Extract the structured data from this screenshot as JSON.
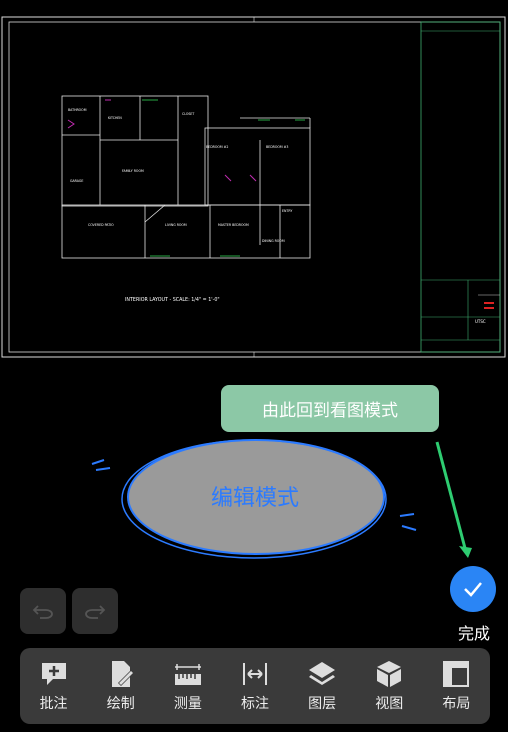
{
  "drawing": {
    "caption": "INTERIOR LAYOUT - SCALE: 1/4\" = 1'-0\"",
    "rooms": [
      "BATHROOM",
      "GARAGE",
      "FAMILY ROOM",
      "KITCHEN",
      "BEDROOM #2",
      "BEDROOM #3",
      "LIVING ROOM",
      "MASTER BEDROOM",
      "COVERED PATIO",
      "DINING ROOM",
      "CLOSET",
      "ENTRY"
    ],
    "title_block": [
      "UTSC"
    ]
  },
  "hint": {
    "text": "由此回到看图模式"
  },
  "edit_mode": {
    "label": "编辑模式"
  },
  "done": {
    "label": "完成"
  },
  "toolbar": {
    "items": [
      {
        "label": "批注",
        "icon": "annotate-icon"
      },
      {
        "label": "绘制",
        "icon": "draw-icon"
      },
      {
        "label": "测量",
        "icon": "measure-icon"
      },
      {
        "label": "标注",
        "icon": "dimension-icon"
      },
      {
        "label": "图层",
        "icon": "layers-icon"
      },
      {
        "label": "视图",
        "icon": "view-cube-icon"
      },
      {
        "label": "布局",
        "icon": "layout-icon"
      }
    ]
  },
  "colors": {
    "accent": "#2a85f5",
    "hint_bg": "#8cc8a6",
    "arrow": "#2ecc71",
    "toolbar_bg": "#3a3a3a"
  }
}
